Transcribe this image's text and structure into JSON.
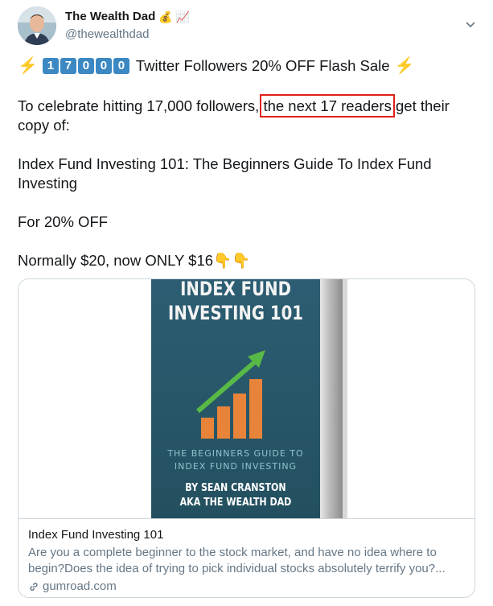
{
  "author": {
    "display_name": "The Wealth Dad",
    "name_emojis": [
      "💰",
      "📈"
    ],
    "handle": "@thewealthdad",
    "avatar_icon": "avatar"
  },
  "tweet": {
    "headline_bolt": "⚡",
    "headline_digits": [
      "1",
      "7",
      "0",
      "0",
      "0"
    ],
    "headline_text": "Twitter Followers 20% OFF Flash Sale",
    "para1_before": "To celebrate hitting 17,000 followers,",
    "para1_highlight": "the next 17 readers",
    "para1_after": "get their",
    "para1_line2": "copy of:",
    "book_line1": "Index Fund Investing 101: The Beginners Guide To Index Fund",
    "book_line2": "Investing",
    "discount": "For 20% OFF",
    "price": "Normally $20, now ONLY $16",
    "price_emoji": "👇👇",
    "highlight_color": "#e0201a"
  },
  "card": {
    "cover_title_line1": "INDEX FUND",
    "cover_title_line2": "INVESTING 101",
    "cover_sub_line1": "THE BEGINNERS GUIDE TO",
    "cover_sub_line2": "INDEX FUND INVESTING",
    "cover_author_line1": "BY SEAN CRANSTON",
    "cover_author_line2": "AKA THE WEALTH DAD",
    "title": "Index Fund Investing 101",
    "description_line1": "Are you a complete beginner to the stock market, and have no idea where to",
    "description_line2": "begin?Does the idea of trying to pick individual stocks absolutely terrify you?...",
    "domain": "gumroad.com"
  },
  "colors": {
    "bolt": "#f5b900",
    "digit_box": "#3b88c3",
    "bars": "#e8843a",
    "arrow": "#58b947"
  }
}
